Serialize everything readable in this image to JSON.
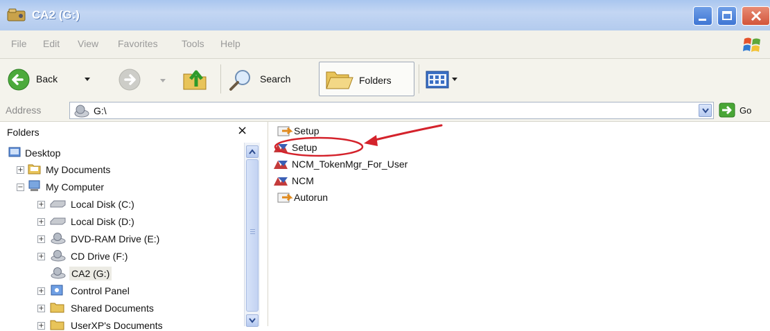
{
  "window": {
    "title": "CA2 (G:)"
  },
  "menu": [
    "File",
    "Edit",
    "View",
    "Favorites",
    "Tools",
    "Help"
  ],
  "toolbar": {
    "back": "Back",
    "search": "Search",
    "folders": "Folders"
  },
  "address": {
    "label": "Address",
    "value": "G:\\",
    "go": "Go"
  },
  "folders_pane": {
    "title": "Folders",
    "close": "×",
    "tree": [
      {
        "label": "Desktop",
        "level": 0,
        "expander": ""
      },
      {
        "label": "My Documents",
        "level": 1,
        "expander": "+"
      },
      {
        "label": "My Computer",
        "level": 1,
        "expander": "−"
      },
      {
        "label": "Local Disk (C:)",
        "level": 2,
        "expander": "+"
      },
      {
        "label": "Local Disk (D:)",
        "level": 2,
        "expander": "+"
      },
      {
        "label": "DVD-RAM Drive (E:)",
        "level": 2,
        "expander": "+"
      },
      {
        "label": "CD Drive (F:)",
        "level": 2,
        "expander": "+"
      },
      {
        "label": "CA2 (G:)",
        "level": 2,
        "expander": "",
        "selected": true
      },
      {
        "label": "Control Panel",
        "level": 2,
        "expander": "+"
      },
      {
        "label": "Shared Documents",
        "level": 2,
        "expander": "+"
      },
      {
        "label": "UserXP's Documents",
        "level": 2,
        "expander": "+"
      }
    ]
  },
  "files": [
    {
      "name": "Setup",
      "icon": "setup-icon"
    },
    {
      "name": "Setup",
      "icon": "msi-icon",
      "highlighted": true
    },
    {
      "name": "NCM_TokenMgr_For_User",
      "icon": "msi-icon"
    },
    {
      "name": "NCM",
      "icon": "msi-icon"
    },
    {
      "name": "Autorun",
      "icon": "setup-icon"
    }
  ],
  "annotation": {
    "color": "#d4222b"
  },
  "colors": {
    "titlebar": "#b3cbee",
    "chrome": "#f4f3ec",
    "annotation": "#d4222b"
  }
}
